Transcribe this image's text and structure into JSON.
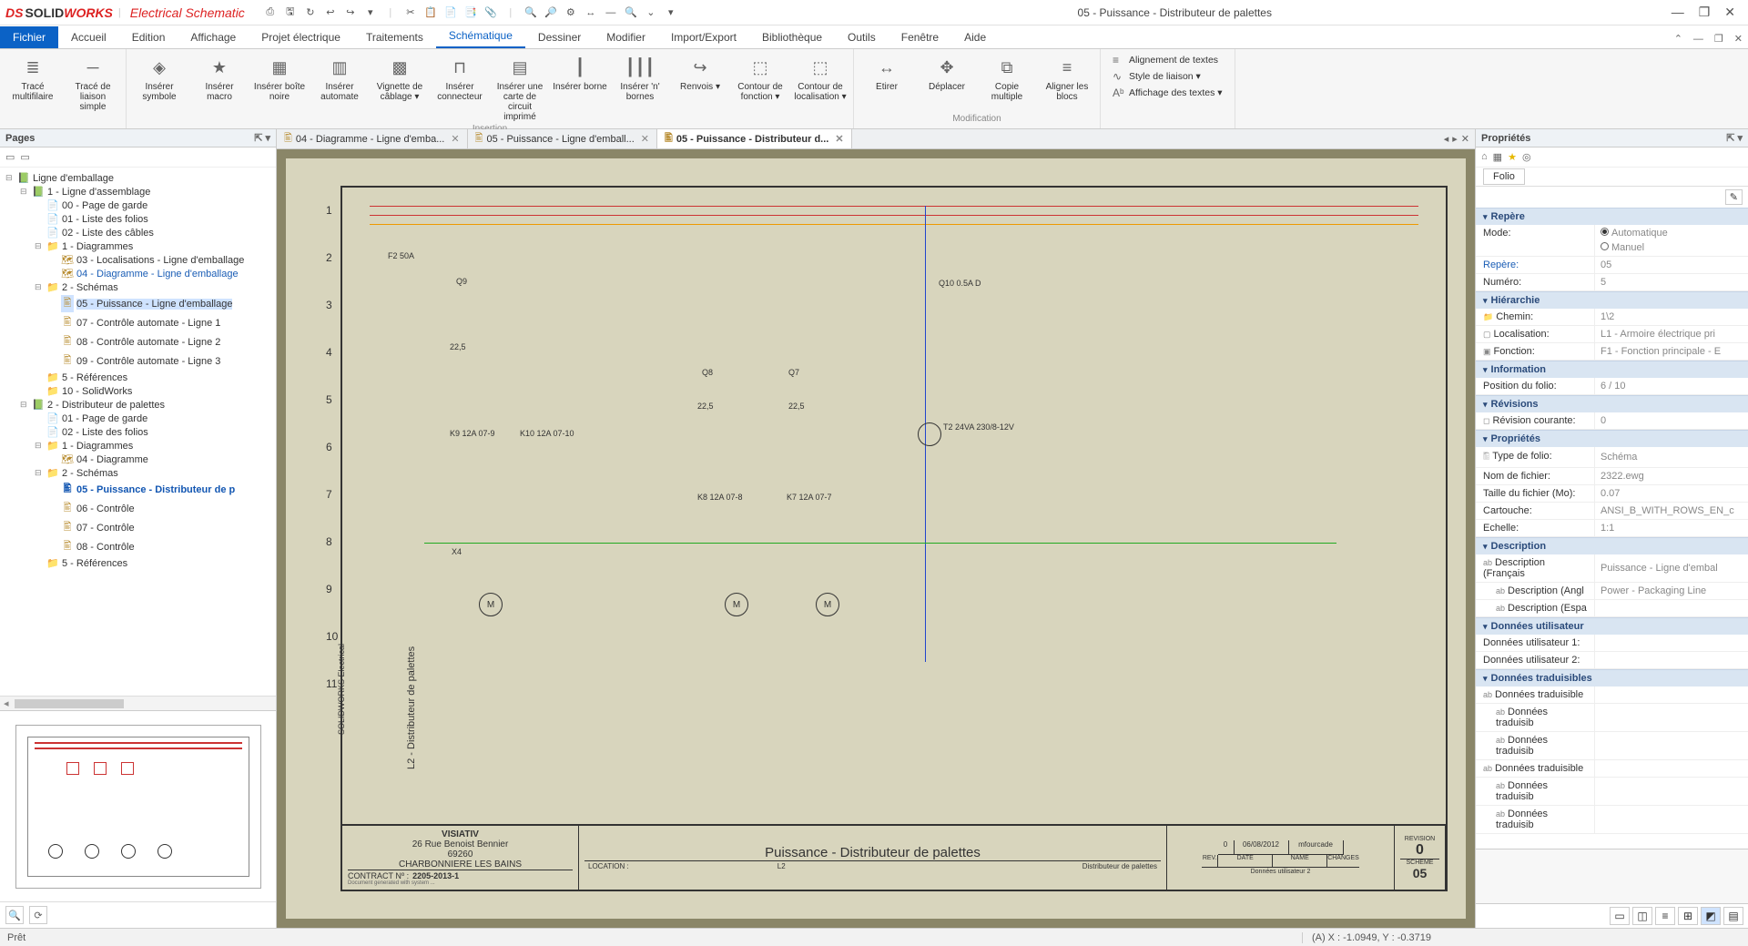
{
  "app": {
    "brand_pre": "DS",
    "brand1": "SOLID",
    "brand2": "WORKS",
    "product": "Electrical Schematic",
    "window_title": "05 - Puissance - Distributeur de palettes"
  },
  "qat": [
    "⎙",
    "🖫",
    "↻",
    "↩",
    "↪",
    "▾",
    "|",
    "✂",
    "📋",
    "📄",
    "📑",
    "📎",
    "|",
    "🔍",
    "🔎",
    "⚙",
    "↔",
    "—",
    "🔍",
    "⌄",
    "▾"
  ],
  "winbtns": {
    "min": "—",
    "max": "❐",
    "close": "✕"
  },
  "menu": {
    "file": "Fichier",
    "tabs": [
      "Accueil",
      "Edition",
      "Affichage",
      "Projet électrique",
      "Traitements",
      "Schématique",
      "Dessiner",
      "Modifier",
      "Import/Export",
      "Bibliothèque",
      "Outils",
      "Fenêtre",
      "Aide"
    ],
    "active": "Schématique"
  },
  "ribbon": {
    "groups": [
      {
        "name": "",
        "items": [
          {
            "label": "Tracé multifilaire",
            "icon": "≣"
          },
          {
            "label": "Tracé de liaison simple",
            "icon": "─"
          }
        ]
      },
      {
        "name": "Insertion",
        "items": [
          {
            "label": "Insérer symbole",
            "icon": "◈"
          },
          {
            "label": "Insérer macro",
            "icon": "★"
          },
          {
            "label": "Insérer boîte noire",
            "icon": "▦"
          },
          {
            "label": "Insérer automate",
            "icon": "▥"
          },
          {
            "label": "Vignette de câblage ▾",
            "icon": "▩"
          },
          {
            "label": "Insérer connecteur",
            "icon": "⊓"
          },
          {
            "label": "Insérer une carte de circuit imprimé",
            "icon": "▤"
          },
          {
            "label": "Insérer borne",
            "icon": "┃"
          },
          {
            "label": "Insérer 'n' bornes",
            "icon": "┃┃┃"
          },
          {
            "label": "Renvois ▾",
            "icon": "↪"
          },
          {
            "label": "Contour de fonction ▾",
            "icon": "⬚"
          },
          {
            "label": "Contour de localisation ▾",
            "icon": "⬚"
          }
        ]
      },
      {
        "name": "Modification",
        "items": [
          {
            "label": "Etirer",
            "icon": "↔"
          },
          {
            "label": "Déplacer",
            "icon": "✥"
          },
          {
            "label": "Copie multiple",
            "icon": "⧉"
          },
          {
            "label": "Aligner les blocs",
            "icon": "≡"
          }
        ]
      }
    ],
    "small": [
      {
        "label": "Alignement de textes",
        "icon": "≡"
      },
      {
        "label": "Style de liaison ▾",
        "icon": "∿"
      },
      {
        "label": "Affichage des textes ▾",
        "icon": "Aᵇ"
      }
    ]
  },
  "pages_panel": {
    "title": "Pages",
    "tree": [
      {
        "type": "book",
        "label": "Ligne d'emballage",
        "children": [
          {
            "type": "book",
            "label": "1 - Ligne d'assemblage",
            "children": [
              {
                "type": "page",
                "label": "00 - Page de garde"
              },
              {
                "type": "page",
                "label": "01 - Liste des folios"
              },
              {
                "type": "page",
                "label": "02 - Liste des câbles"
              },
              {
                "type": "folder",
                "label": "1 - Diagrammes",
                "children": [
                  {
                    "type": "diag",
                    "label": "03 - Localisations - Ligne d'emballage"
                  },
                  {
                    "type": "diag",
                    "label": "04 - Diagramme - Ligne d'emballage",
                    "link": true
                  }
                ]
              },
              {
                "type": "folder",
                "label": "2 - Schémas",
                "children": [
                  {
                    "type": "sch",
                    "label": "05 - Puissance - Ligne d'emballage",
                    "sel": true
                  },
                  {
                    "type": "sch",
                    "label": "07 - Contrôle automate - Ligne 1"
                  },
                  {
                    "type": "sch",
                    "label": "08 - Contrôle automate - Ligne 2"
                  },
                  {
                    "type": "sch",
                    "label": "09 - Contrôle automate - Ligne 3"
                  }
                ]
              },
              {
                "type": "folder",
                "label": "5 - Références",
                "closed": true
              },
              {
                "type": "folder",
                "label": "10 - SolidWorks",
                "closed": true
              }
            ]
          },
          {
            "type": "book",
            "label": "2 - Distributeur de palettes",
            "children": [
              {
                "type": "page",
                "label": "01 - Page de garde"
              },
              {
                "type": "page",
                "label": "02 - Liste des folios"
              },
              {
                "type": "folder",
                "label": "1 - Diagrammes",
                "children": [
                  {
                    "type": "diag",
                    "label": "04 - Diagramme"
                  }
                ]
              },
              {
                "type": "folder",
                "label": "2 - Schémas",
                "children": [
                  {
                    "type": "sch",
                    "label": "05 - Puissance - Distributeur de p",
                    "bold": true
                  },
                  {
                    "type": "sch",
                    "label": "06 - Contrôle"
                  },
                  {
                    "type": "sch",
                    "label": "07 - Contrôle"
                  },
                  {
                    "type": "sch",
                    "label": "08 - Contrôle"
                  }
                ]
              },
              {
                "type": "folder",
                "label": "5 - Références",
                "closed": true
              }
            ]
          }
        ]
      }
    ]
  },
  "doctabs": [
    {
      "label": "04 - Diagramme - Ligne d'emba...",
      "active": false
    },
    {
      "label": "05 - Puissance - Ligne d'emball...",
      "active": false
    },
    {
      "label": "05 - Puissance - Distributeur d...",
      "active": true
    }
  ],
  "drawing": {
    "rows": [
      "1",
      "2",
      "3",
      "4",
      "5",
      "6",
      "7",
      "8",
      "9",
      "10",
      "11"
    ],
    "vlabel": "L2 - Distributeur de palettes",
    "vlabel2": "SOLIDWORKS Electrical",
    "components": {
      "F2": "F2 50A",
      "Q9": "Q9",
      "Q8": "Q8",
      "Q7": "Q7",
      "Q10": "Q10 0.5A D",
      "K9": "K9 12A 07-9",
      "K10": "K10 12A 07-10",
      "K8": "K8 12A 07-8",
      "K7": "K7 12A 07-7",
      "T2": "T2 24VA 230/8-12V",
      "X4": "X4",
      "M": "M",
      "v225": "22,5"
    },
    "titleblock": {
      "company": "VISIATIV",
      "addr1": "26 Rue Benoist Bennier",
      "addr2": "69260",
      "addr3": "CHARBONNIERE LES BAINS",
      "contract_k": "CONTRACT Nº :",
      "contract_v": "2205-2013-1",
      "title": "Puissance  -  Distributeur de palettes",
      "loc_k": "LOCATION :",
      "loc_v": "L2",
      "func": "Distributeur de palettes",
      "rev_h": "REVISION",
      "rev_v": "0",
      "scheme_h": "SCHEME",
      "scheme_v": "05",
      "date": "06/08/2012",
      "by": "mfourcade",
      "col_rev": "REV.",
      "col_date": "DATE",
      "col_name": "NAME",
      "col_changes": "CHANGES",
      "foot": "Données utilisateur 2",
      "gen": "Document generated with system ..."
    }
  },
  "props": {
    "title": "Propriétés",
    "folio_tab": "Folio",
    "groups": [
      {
        "name": "Repère",
        "rows": [
          {
            "k": "Mode:",
            "v": "",
            "radios": [
              {
                "label": "Automatique",
                "on": true
              },
              {
                "label": "Manuel",
                "on": false
              }
            ]
          },
          {
            "k": "Repère:",
            "v": "05",
            "link": true
          },
          {
            "k": "Numéro:",
            "v": "5"
          }
        ]
      },
      {
        "name": "Hiérarchie",
        "rows": [
          {
            "k": "Chemin:",
            "v": "1\\2",
            "icon": "📁"
          },
          {
            "k": "Localisation:",
            "v": "L1 - Armoire électrique pri",
            "icon": "▢"
          },
          {
            "k": "Fonction:",
            "v": "F1 - Fonction principale - E",
            "icon": "▣"
          }
        ]
      },
      {
        "name": "Information",
        "rows": [
          {
            "k": "Position du folio:",
            "v": "6 / 10"
          }
        ]
      },
      {
        "name": "Révisions",
        "rows": [
          {
            "k": "Révision courante:",
            "v": "0",
            "icon": "◻"
          }
        ]
      },
      {
        "name": "Propriétés",
        "rows": [
          {
            "k": "Type de folio:",
            "v": "Schéma",
            "icon": "🖺"
          },
          {
            "k": "Nom de fichier:",
            "v": "2322.ewg"
          },
          {
            "k": "Taille du fichier (Mo):",
            "v": "0.07"
          },
          {
            "k": "Cartouche:",
            "v": "ANSI_B_WITH_ROWS_EN_c"
          },
          {
            "k": "Echelle:",
            "v": "1:1"
          }
        ]
      },
      {
        "name": "Description",
        "rows": [
          {
            "k": "Description (Français",
            "v": "Puissance - Ligne d'embal",
            "icon": "ab"
          },
          {
            "k": "Description (Angl",
            "v": "Power - Packaging Line",
            "icon": "ab",
            "indent": true
          },
          {
            "k": "Description (Espa",
            "v": "",
            "icon": "ab",
            "indent": true
          }
        ]
      },
      {
        "name": "Données utilisateur",
        "rows": [
          {
            "k": "Données utilisateur 1:",
            "v": ""
          },
          {
            "k": "Données utilisateur 2:",
            "v": ""
          }
        ]
      },
      {
        "name": "Données traduisibles",
        "rows": [
          {
            "k": "Données traduisible",
            "v": "",
            "icon": "ab"
          },
          {
            "k": "Données traduisib",
            "v": "",
            "icon": "ab",
            "indent": true
          },
          {
            "k": "Données traduisib",
            "v": "",
            "icon": "ab",
            "indent": true
          },
          {
            "k": "Données traduisible",
            "v": "",
            "icon": "ab"
          },
          {
            "k": "Données traduisib",
            "v": "",
            "icon": "ab",
            "indent": true
          },
          {
            "k": "Données traduisib",
            "v": "",
            "icon": "ab",
            "indent": true
          }
        ]
      }
    ]
  },
  "status": {
    "ready": "Prêt",
    "coord": "(A) X : -1.0949, Y : -0.3719"
  }
}
